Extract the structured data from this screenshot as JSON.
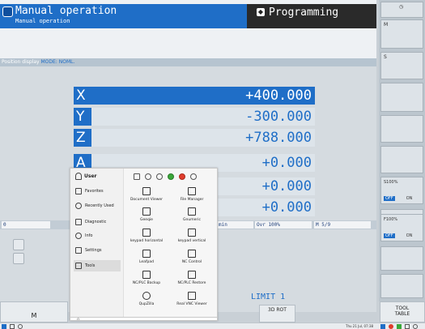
{
  "header": {
    "title": "Manual operation",
    "subtitle": "Manual operation",
    "mode": "Programming"
  },
  "position_display": {
    "label": "Position display",
    "mode": "MODE: NOML."
  },
  "axes": [
    {
      "letter": "X",
      "value": "+400.000"
    },
    {
      "letter": "Y",
      "value": "-300.000"
    },
    {
      "letter": "Z",
      "value": "+788.000"
    },
    {
      "letter": "A",
      "value": "+0.000"
    },
    {
      "letter": "",
      "value": "+0.000"
    },
    {
      "letter": "",
      "value": "+0.000"
    }
  ],
  "status": {
    "feed": "min",
    "override": "Ovr 100%",
    "m": "M 5/9",
    "t": "0"
  },
  "limit_text": "LIMIT 1",
  "softkeys": {
    "m": "M",
    "rot": "3D ROT",
    "tool_table_1": "TOOL",
    "tool_table_2": "TABLE"
  },
  "right_panel": {
    "m_label": "M",
    "s_label": "S",
    "s100": "S100%",
    "f100": "F100%",
    "off": "OFF",
    "on": "ON"
  },
  "menu": {
    "user": "User",
    "left_items": [
      "Favorites",
      "Recently Used",
      "Diagnostic",
      "Info",
      "Settings",
      "Tools"
    ],
    "selected": "Tools",
    "apps": [
      "Document Viewer",
      "File Manager",
      "Geeqie",
      "Gnumeric",
      "keypad horizontal",
      "keypad vertical",
      "Leafpad",
      "NC Control",
      "NC/PLC Backup",
      "NC/PLC Restore",
      "QupZilla",
      "Real VNC Viewer"
    ],
    "search_placeholder": "Q"
  },
  "taskbar": {
    "clock": "Thu 21 Jul, 07:38"
  }
}
